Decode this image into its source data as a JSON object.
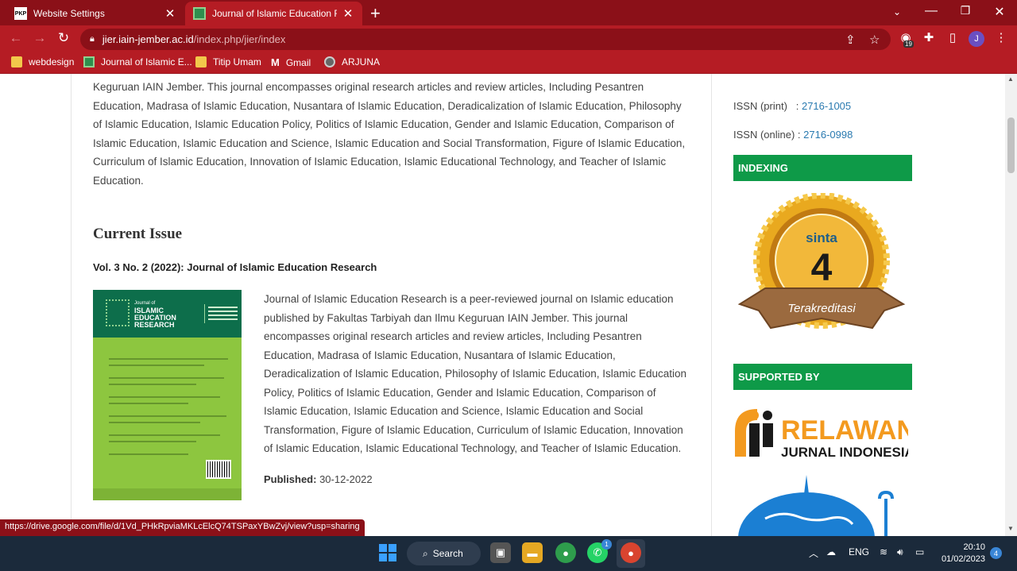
{
  "tabs": [
    {
      "label": "Website Settings",
      "favicon": "PKP"
    },
    {
      "label": "Journal of Islamic Education Rese",
      "favicon": "jier"
    }
  ],
  "address_bar": {
    "host": "jier.iain-jember.ac.id",
    "path": "/index.php/jier/index"
  },
  "extension_badge": "19",
  "profile_initial": "J",
  "bookmarks": [
    "webdesign",
    "Journal of Islamic E...",
    "Titip Umam",
    "Gmail",
    "ARJUNA"
  ],
  "main": {
    "intro_text": "Keguruan IAIN Jember. This journal encompasses original research articles and review articles, Including Pesantren Education, Madrasa of Islamic Education, Nusantara of Islamic Education, Deradicalization of Islamic Education, Philosophy of Islamic Education, Islamic Education Policy, Politics of Islamic Education, Gender and Islamic Education, Comparison of Islamic Education, Islamic Education and Science, Islamic Education and Social Transformation, Figure of Islamic Education, Curriculum of Islamic Education, Innovation of Islamic Education, Islamic Educational Technology, and Teacher of Islamic Education.",
    "current_issue_heading": "Current Issue",
    "issue_title": "Vol. 3 No. 2 (2022): Journal of Islamic Education Research",
    "cover": {
      "subtitle": "Journal of",
      "line1": "ISLAMIC",
      "line2": "EDUCATION",
      "line3": "RESEARCH"
    },
    "issue_description": "Journal of Islamic Education Research is a peer-reviewed journal on Islamic education published by Fakultas Tarbiyah dan Ilmu Keguruan IAIN Jember. This journal encompasses original research articles and review articles, Including Pesantren Education, Madrasa of Islamic Education, Nusantara of Islamic Education, Deradicalization of Islamic Education, Philosophy of Islamic Education, Islamic Education Policy, Politics of Islamic Education, Gender and Islamic Education, Comparison of Islamic Education, Islamic Education and Science, Islamic Education and Social Transformation, Figure of Islamic Education, Curriculum of Islamic Education, Innovation of Islamic Education, Islamic Educational Technology, and Teacher of Islamic Education.",
    "published_label": "Published:",
    "published_date": "30-12-2022"
  },
  "sidebar": {
    "issn_print_label": "ISSN (print)",
    "issn_print": "2716-1005",
    "issn_online_label": "ISSN (online) :",
    "issn_online": "2716-0998",
    "indexing_heading": "INDEXING",
    "sinta_brand": "sinta",
    "sinta_rank": "4",
    "sinta_ribbon": "Terakreditasi",
    "supported_heading": "SUPPORTED BY",
    "relawan_word": "RELAWAN",
    "relawan_sub": "JURNAL INDONESIA"
  },
  "status_url": "https://drive.google.com/file/d/1Vd_PHkRpviaMKLcElcQ74TSPaxYBwZvj/view?usp=sharing",
  "taskbar": {
    "search_label": "Search",
    "lang": "ENG",
    "time": "20:10",
    "date": "01/02/2023",
    "notification_count": "4",
    "whatsapp_badge": "1"
  },
  "colors": {
    "chrome_dark": "#8b1018",
    "chrome": "#b51c24",
    "sidebar_green": "#0e9a48",
    "link_blue": "#2a7ab0"
  }
}
